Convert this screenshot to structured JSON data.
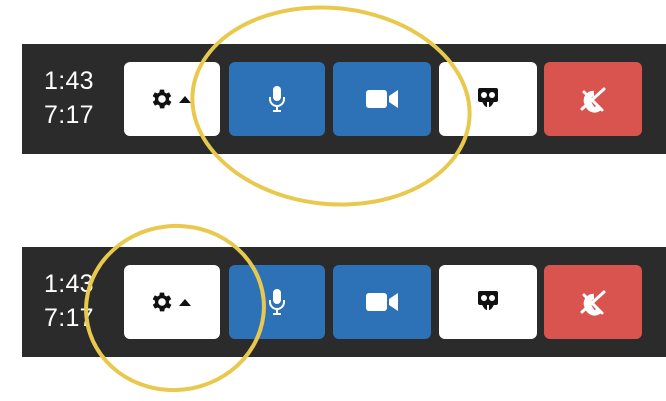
{
  "toolbars": [
    {
      "time_elapsed": "1:43",
      "time_total": "7:17",
      "buttons": {
        "settings": "gear-icon",
        "mic": "microphone-icon",
        "camera": "video-camera-icon",
        "slides": "slideshare-icon",
        "hangup": "hang-up-icon"
      }
    },
    {
      "time_elapsed": "1:43",
      "time_total": "7:17",
      "buttons": {
        "settings": "gear-icon",
        "mic": "microphone-icon",
        "camera": "video-camera-icon",
        "slides": "slideshare-icon",
        "hangup": "hang-up-icon"
      }
    }
  ],
  "colors": {
    "bar": "#2b2b2b",
    "blue_button": "#2d72b6",
    "red_button": "#d9534f",
    "highlight_ring": "#e8c94e"
  }
}
